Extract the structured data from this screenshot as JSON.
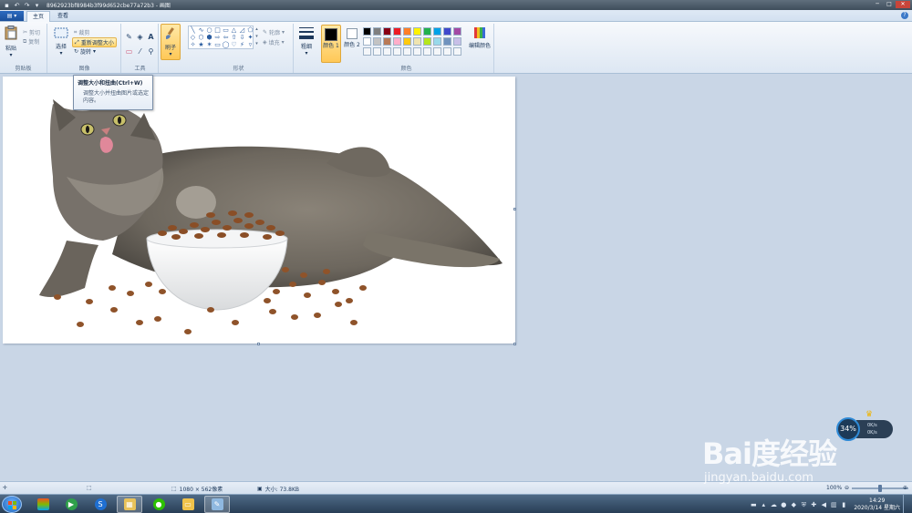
{
  "window": {
    "title": "8962923bf8984b3f99d652cbe77a72b3 - 画图",
    "minimize_glyph": "─",
    "maximize_glyph": "□",
    "close_glyph": "✕"
  },
  "quick_access": {
    "icons": [
      "save-icon",
      "undo-icon",
      "redo-icon",
      "customize-icon"
    ],
    "save_glyph": "▪",
    "undo_glyph": "↶",
    "redo_glyph": "↷",
    "customize_glyph": "▾"
  },
  "menu": {
    "file_label": "▤ ▾",
    "tabs": [
      {
        "label": "主页",
        "active": true
      },
      {
        "label": "查看",
        "active": false
      }
    ],
    "help_glyph": "?"
  },
  "ribbon": {
    "clipboard": {
      "group_label": "剪贴板",
      "paste_label": "粘贴",
      "cut_label": "剪切",
      "copy_label": "复制"
    },
    "image": {
      "group_label": "图像",
      "select_label": "选择",
      "crop_label": "裁剪",
      "resize_label": "重新调整大小",
      "rotate_label": "旋转"
    },
    "tools": {
      "group_label": "工具",
      "pencil_glyph": "✎",
      "fill_glyph": "◈",
      "text_glyph": "A",
      "eraser_glyph": "▭",
      "picker_glyph": "⁄",
      "magnifier_glyph": "⚲"
    },
    "brushes": {
      "label": "刷子"
    },
    "shapes": {
      "group_label": "形状",
      "glyphs": [
        "╲",
        "∿",
        "○",
        "□",
        "▭",
        "△",
        "◿",
        "⬠",
        "◇",
        "⬡",
        "⬢",
        "⇨",
        "⇦",
        "⇧",
        "⇩",
        "✦",
        "✧",
        "★",
        "✶",
        "▭",
        "◯",
        "♡",
        "⚡",
        "▿"
      ],
      "outline_label": "轮廓",
      "fill_label": "填充"
    },
    "size": {
      "label": "粗细"
    },
    "colors": {
      "group_label": "颜色",
      "color1_label": "颜色 1",
      "color2_label": "颜色 2",
      "edit_label": "编辑颜色",
      "color1": "#000000",
      "color2": "#ffffff",
      "palette_row1": [
        "#000000",
        "#7f7f7f",
        "#880015",
        "#ed1c24",
        "#ff7f27",
        "#fff200",
        "#22b14c",
        "#00a2e8",
        "#3f48cc",
        "#a349a4"
      ],
      "palette_row2": [
        "#ffffff",
        "#c3c3c3",
        "#b97a57",
        "#ffaec9",
        "#ffc90e",
        "#efe4b0",
        "#b5e61d",
        "#99d9ea",
        "#7092be",
        "#c8bfe7"
      ]
    }
  },
  "tooltip": {
    "title": "调整大小和扭曲(Ctrl+W)",
    "description": "调整大小并扭曲图片或选定内容。"
  },
  "statusbar": {
    "dimensions": "1080 × 562像素",
    "size": "大小: 73.8KB",
    "zoom": "100%",
    "zoom_out_glyph": "⊖",
    "zoom_in_glyph": "⊕",
    "zoom_fraction": 0.5
  },
  "netmon": {
    "percent": "34%",
    "up_speed": "0K/s",
    "down_speed": "0K/s"
  },
  "taskbar": {
    "apps": [
      "ie-icon",
      "media-player-icon",
      "sogou-icon",
      "paint-app-icon",
      "wechat-icon",
      "explorer-icon",
      "paint-icon"
    ],
    "clock_time": "14:29",
    "clock_date": "2020/3/14 星期六"
  },
  "watermark": {
    "logo_text": "Bai度经验",
    "url": "jingyan.baidu.com"
  }
}
